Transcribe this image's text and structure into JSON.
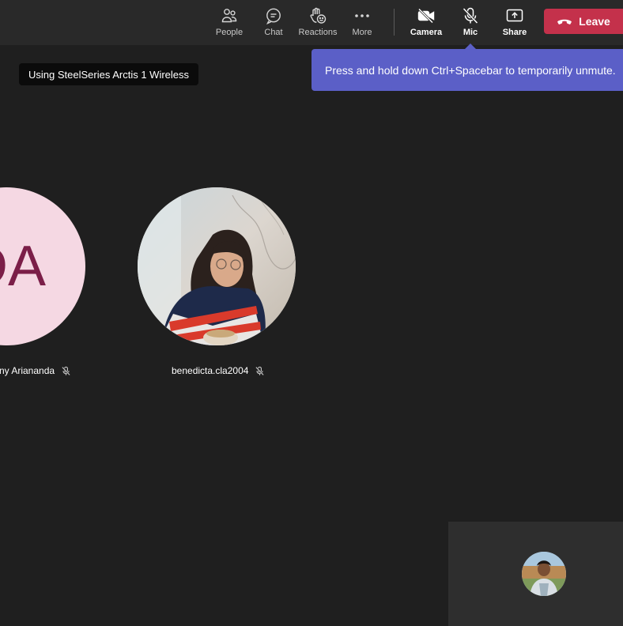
{
  "toolbar": {
    "people_label": "People",
    "chat_label": "Chat",
    "reactions_label": "Reactions",
    "more_label": "More",
    "camera_label": "Camera",
    "mic_label": "Mic",
    "share_label": "Share",
    "leave_label": "Leave",
    "leave_color": "#c4314b"
  },
  "device": {
    "label": "Using SteelSeries Arctis 1 Wireless"
  },
  "tooltip": {
    "text": "Press and hold down Ctrl+Spacebar to temporarily unmute.",
    "color": "#5b5fc7"
  },
  "participants": [
    {
      "name": "ny Ariananda",
      "initials": "DA",
      "avatar_bg": "#f5d8e3",
      "initials_color": "#7b1e48",
      "muted": true
    },
    {
      "name": "benedicta.cla2004",
      "avatar": "photo-avatar",
      "muted": true
    }
  ],
  "self_view": {
    "avatar": "photo-avatar"
  }
}
